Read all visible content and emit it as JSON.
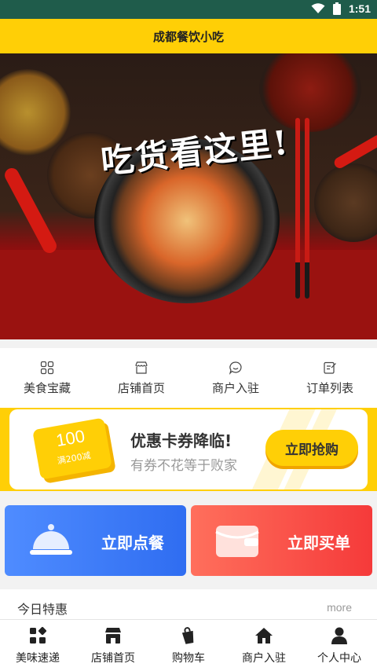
{
  "status_bar": {
    "time": "1:51",
    "icons": [
      "wifi-icon",
      "battery-icon"
    ]
  },
  "header": {
    "title": "成都餐饮小吃"
  },
  "banner": {
    "headline": "吃货看这里!"
  },
  "quick_nav": [
    {
      "label": "美食宝藏",
      "icon": "grid-icon"
    },
    {
      "label": "店铺首页",
      "icon": "store-icon"
    },
    {
      "label": "商户入驻",
      "icon": "chat-icon"
    },
    {
      "label": "订单列表",
      "icon": "edit-icon"
    }
  ],
  "coupon": {
    "amount": "100",
    "condition": "满200减",
    "title": "优惠卡券降临!",
    "subtitle": "有券不花等于败家",
    "button": "立即抢购"
  },
  "actions": [
    {
      "label": "立即点餐",
      "icon": "cloche-icon"
    },
    {
      "label": "立即买单",
      "icon": "wallet-icon"
    }
  ],
  "today_special": {
    "title": "今日特惠",
    "more": "more"
  },
  "tab_bar": [
    {
      "label": "美味速递",
      "icon": "grid-plus-icon"
    },
    {
      "label": "店铺首页",
      "icon": "shop-icon"
    },
    {
      "label": "购物车",
      "icon": "bag-icon"
    },
    {
      "label": "商户入驻",
      "icon": "home-icon"
    },
    {
      "label": "个人中心",
      "icon": "person-icon"
    }
  ],
  "colors": {
    "accent": "#ffcf06",
    "status_bar": "#1f5c4b",
    "blue_card": "#3d7bf7",
    "red_card": "#f74b45"
  }
}
